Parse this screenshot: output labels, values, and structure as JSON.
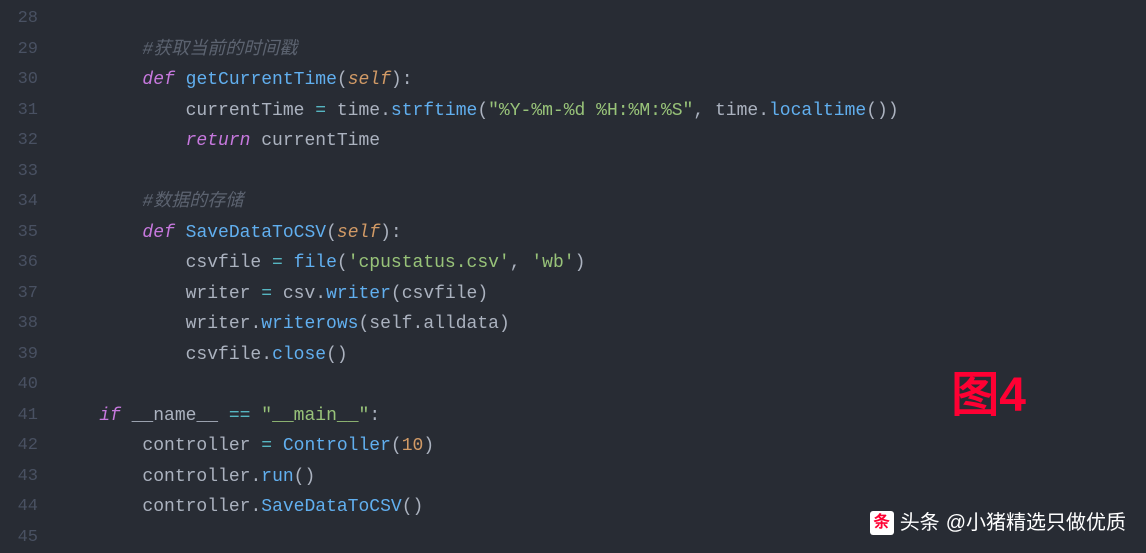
{
  "lines": [
    {
      "num": "28",
      "tokens": []
    },
    {
      "num": "29",
      "tokens": [
        {
          "cls": "",
          "t": "        "
        },
        {
          "cls": "tok-comment",
          "t": "#获取当前的时间戳"
        }
      ]
    },
    {
      "num": "30",
      "tokens": [
        {
          "cls": "",
          "t": "        "
        },
        {
          "cls": "tok-keyword-def",
          "t": "def"
        },
        {
          "cls": "",
          "t": " "
        },
        {
          "cls": "tok-func",
          "t": "getCurrentTime"
        },
        {
          "cls": "tok-punc",
          "t": "("
        },
        {
          "cls": "tok-self",
          "t": "self"
        },
        {
          "cls": "tok-punc",
          "t": "):"
        }
      ]
    },
    {
      "num": "31",
      "tokens": [
        {
          "cls": "",
          "t": "            "
        },
        {
          "cls": "tok-var",
          "t": "currentTime "
        },
        {
          "cls": "tok-op",
          "t": "="
        },
        {
          "cls": "tok-var",
          "t": " time"
        },
        {
          "cls": "tok-punc",
          "t": "."
        },
        {
          "cls": "tok-func",
          "t": "strftime"
        },
        {
          "cls": "tok-punc",
          "t": "("
        },
        {
          "cls": "tok-string",
          "t": "\"%Y-%m-%d %H:%M:%S\""
        },
        {
          "cls": "tok-punc",
          "t": ", "
        },
        {
          "cls": "tok-var",
          "t": "time"
        },
        {
          "cls": "tok-punc",
          "t": "."
        },
        {
          "cls": "tok-func",
          "t": "localtime"
        },
        {
          "cls": "tok-punc",
          "t": "())"
        }
      ]
    },
    {
      "num": "32",
      "tokens": [
        {
          "cls": "",
          "t": "            "
        },
        {
          "cls": "tok-return",
          "t": "return"
        },
        {
          "cls": "tok-var",
          "t": " currentTime"
        }
      ]
    },
    {
      "num": "33",
      "tokens": []
    },
    {
      "num": "34",
      "tokens": [
        {
          "cls": "",
          "t": "        "
        },
        {
          "cls": "tok-comment",
          "t": "#数据的存储"
        }
      ]
    },
    {
      "num": "35",
      "tokens": [
        {
          "cls": "",
          "t": "        "
        },
        {
          "cls": "tok-keyword-def",
          "t": "def"
        },
        {
          "cls": "",
          "t": " "
        },
        {
          "cls": "tok-func",
          "t": "SaveDataToCSV"
        },
        {
          "cls": "tok-punc",
          "t": "("
        },
        {
          "cls": "tok-self",
          "t": "self"
        },
        {
          "cls": "tok-punc",
          "t": "):"
        }
      ]
    },
    {
      "num": "36",
      "tokens": [
        {
          "cls": "",
          "t": "            "
        },
        {
          "cls": "tok-var",
          "t": "csvfile "
        },
        {
          "cls": "tok-op",
          "t": "="
        },
        {
          "cls": "tok-var",
          "t": " "
        },
        {
          "cls": "tok-func",
          "t": "file"
        },
        {
          "cls": "tok-punc",
          "t": "("
        },
        {
          "cls": "tok-string",
          "t": "'cpustatus.csv'"
        },
        {
          "cls": "tok-punc",
          "t": ", "
        },
        {
          "cls": "tok-string",
          "t": "'wb'"
        },
        {
          "cls": "tok-punc",
          "t": ")"
        }
      ]
    },
    {
      "num": "37",
      "tokens": [
        {
          "cls": "",
          "t": "            "
        },
        {
          "cls": "tok-var",
          "t": "writer "
        },
        {
          "cls": "tok-op",
          "t": "="
        },
        {
          "cls": "tok-var",
          "t": " csv"
        },
        {
          "cls": "tok-punc",
          "t": "."
        },
        {
          "cls": "tok-func",
          "t": "writer"
        },
        {
          "cls": "tok-punc",
          "t": "("
        },
        {
          "cls": "tok-var",
          "t": "csvfile"
        },
        {
          "cls": "tok-punc",
          "t": ")"
        }
      ]
    },
    {
      "num": "38",
      "tokens": [
        {
          "cls": "",
          "t": "            "
        },
        {
          "cls": "tok-var",
          "t": "writer"
        },
        {
          "cls": "tok-punc",
          "t": "."
        },
        {
          "cls": "tok-func",
          "t": "writerows"
        },
        {
          "cls": "tok-punc",
          "t": "("
        },
        {
          "cls": "tok-var",
          "t": "self"
        },
        {
          "cls": "tok-punc",
          "t": "."
        },
        {
          "cls": "tok-var",
          "t": "alldata"
        },
        {
          "cls": "tok-punc",
          "t": ")"
        }
      ]
    },
    {
      "num": "39",
      "tokens": [
        {
          "cls": "",
          "t": "            "
        },
        {
          "cls": "tok-var",
          "t": "csvfile"
        },
        {
          "cls": "tok-punc",
          "t": "."
        },
        {
          "cls": "tok-func",
          "t": "close"
        },
        {
          "cls": "tok-punc",
          "t": "()"
        }
      ]
    },
    {
      "num": "40",
      "tokens": []
    },
    {
      "num": "41",
      "tokens": [
        {
          "cls": "",
          "t": "    "
        },
        {
          "cls": "tok-keyword",
          "t": "if"
        },
        {
          "cls": "tok-var",
          "t": " __name__ "
        },
        {
          "cls": "tok-op",
          "t": "=="
        },
        {
          "cls": "tok-var",
          "t": " "
        },
        {
          "cls": "tok-string",
          "t": "\"__main__\""
        },
        {
          "cls": "tok-punc",
          "t": ":"
        }
      ]
    },
    {
      "num": "42",
      "tokens": [
        {
          "cls": "",
          "t": "        "
        },
        {
          "cls": "tok-var",
          "t": "controller "
        },
        {
          "cls": "tok-op",
          "t": "="
        },
        {
          "cls": "tok-var",
          "t": " "
        },
        {
          "cls": "tok-func",
          "t": "Controller"
        },
        {
          "cls": "tok-punc",
          "t": "("
        },
        {
          "cls": "tok-number",
          "t": "10"
        },
        {
          "cls": "tok-punc",
          "t": ")"
        }
      ]
    },
    {
      "num": "43",
      "tokens": [
        {
          "cls": "",
          "t": "        "
        },
        {
          "cls": "tok-var",
          "t": "controller"
        },
        {
          "cls": "tok-punc",
          "t": "."
        },
        {
          "cls": "tok-func",
          "t": "run"
        },
        {
          "cls": "tok-punc",
          "t": "()"
        }
      ]
    },
    {
      "num": "44",
      "tokens": [
        {
          "cls": "",
          "t": "        "
        },
        {
          "cls": "tok-var",
          "t": "controller"
        },
        {
          "cls": "tok-punc",
          "t": "."
        },
        {
          "cls": "tok-func",
          "t": "SaveDataToCSV"
        },
        {
          "cls": "tok-punc",
          "t": "()"
        }
      ]
    },
    {
      "num": "45",
      "tokens": []
    }
  ],
  "annotation": "图4",
  "watermark": {
    "icon": "条",
    "prefix": "头条",
    "text": "@小猪精选只做优质"
  }
}
